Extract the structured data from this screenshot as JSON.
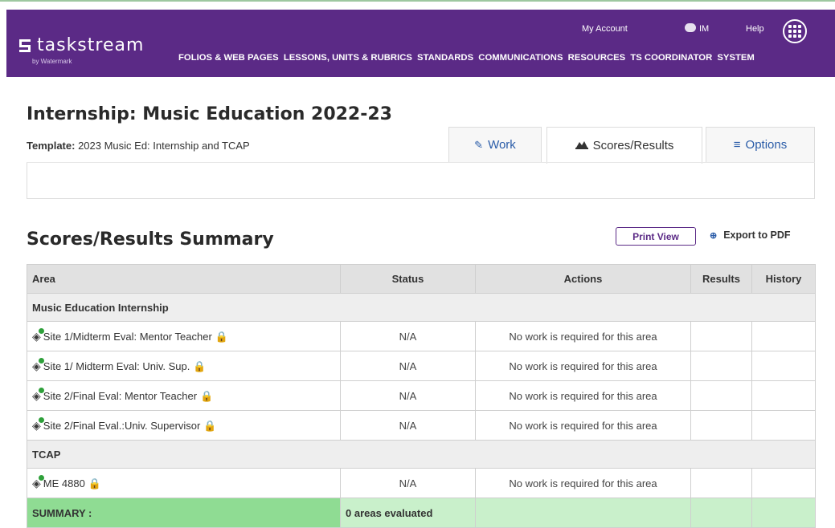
{
  "header": {
    "logo_text": "taskstream",
    "logo_sub": "by Watermark",
    "my_account": "My Account",
    "user_initials": "IM",
    "help": "Help",
    "nav": [
      "FOLIOS & WEB PAGES",
      "LESSONS, UNITS & RUBRICS",
      "STANDARDS",
      "COMMUNICATIONS",
      "RESOURCES",
      "TS COORDINATOR",
      "SYSTEM"
    ]
  },
  "page": {
    "title": "Internship: Music Education 2022-23",
    "template_label": "Template:",
    "template_value": "2023 Music Ed: Internship and TCAP",
    "tabs": {
      "work": "Work",
      "scores": "Scores/Results",
      "options": "Options"
    }
  },
  "summary": {
    "heading": "Scores/Results Summary",
    "print_view": "Print View",
    "export_pdf": "Export to PDF",
    "columns": [
      "Area",
      "Status",
      "Actions",
      "Results",
      "History"
    ],
    "groups": [
      {
        "name": "Music Education Internship",
        "rows": [
          {
            "area": "Site 1/Midterm Eval: Mentor Teacher",
            "status": "N/A",
            "actions": "No work is required for this area"
          },
          {
            "area": "Site 1/ Midterm Eval: Univ. Sup.",
            "status": "N/A",
            "actions": "No work is required for this area"
          },
          {
            "area": "Site 2/Final Eval: Mentor Teacher",
            "status": "N/A",
            "actions": "No work is required for this area"
          },
          {
            "area": "Site 2/Final Eval.:Univ. Supervisor",
            "status": "N/A",
            "actions": "No work is required for this area"
          }
        ]
      },
      {
        "name": "TCAP",
        "rows": [
          {
            "area": "ME 4880",
            "status": "N/A",
            "actions": "No work is required for this area"
          }
        ]
      }
    ],
    "summary_row": {
      "label": "SUMMARY :",
      "status": "0 areas evaluated"
    }
  },
  "colors": {
    "brand_purple": "#5b2a86",
    "link_blue": "#2a5ca8",
    "summary_green": "#8fdc93",
    "summary_light_green": "#c9f0cb"
  },
  "icons": [
    "apps-grid-icon",
    "chat-icon",
    "edit-icon",
    "chart-icon",
    "menu-icon",
    "info-circle-icon",
    "tag-icon",
    "lock-icon"
  ]
}
